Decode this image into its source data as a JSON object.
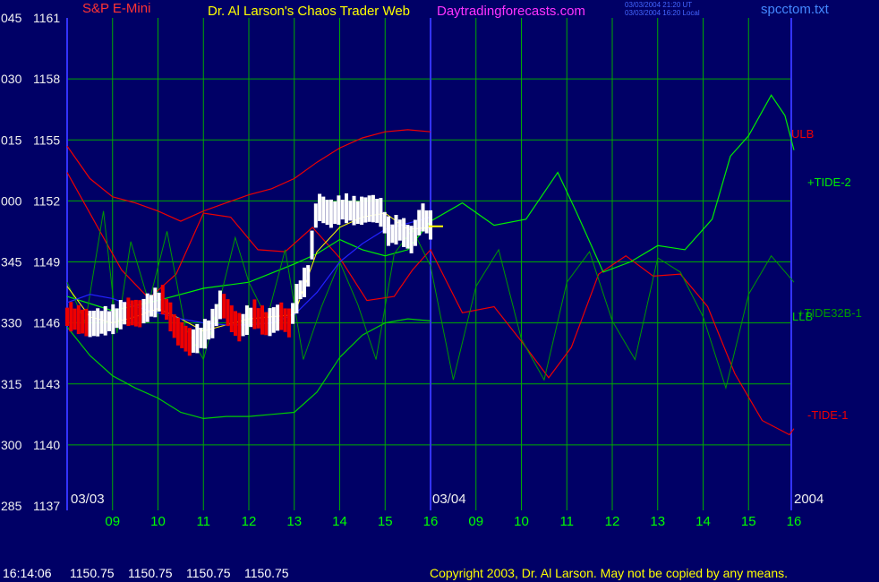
{
  "header": {
    "symbol_label": "S&P E-Mini",
    "title": "Dr. Al Larson's Chaos Trader Web",
    "site": "Daytradingforecasts.com",
    "timestamp_utc": "03/03/2004 21:20 UT",
    "timestamp_local": "03/03/2004 16:20 Local",
    "file": "spcctom.txt"
  },
  "footer": {
    "status_time": "16:14:06",
    "ohlc": [
      "1150.75",
      "1150.75",
      "1150.75",
      "1150.75"
    ],
    "copyright": "Copyright 2003, Dr. Al Larson. May not be copied by any means."
  },
  "colors": {
    "background": "#000066",
    "grid": "#00aa00",
    "axis_labels": "#f0f0f0",
    "time_labels": "#00ff00",
    "divider": "#3333ff",
    "price_bar": "#ffffff",
    "price_bar_down": "#ee0000",
    "ulb": "#ee0000",
    "llb": "#00cc00",
    "tide2": "#00ee00",
    "tide1": "#ee0000",
    "tide32b": "#009900",
    "moving_average_yellow": "#ffff00",
    "moving_average_blue": "#2222ff",
    "site": "#ff33ff",
    "symbol": "#ff3333",
    "title": "#ffff00",
    "file": "#4488ff",
    "copyright": "#ffff00",
    "status": "#ffffff"
  },
  "chart_data": {
    "type": "line",
    "instrument": "S&P E-Mini",
    "y_axis": {
      "ylim": [
        1137,
        1161
      ],
      "prices": [
        "1161",
        "1158",
        "1155",
        "1152",
        "1149",
        "1146",
        "1143",
        "1140",
        "1137"
      ],
      "angles": [
        "045",
        "030",
        "015",
        "000",
        "345",
        "330",
        "315",
        "300",
        "285"
      ]
    },
    "x_axis": {
      "sessions": [
        "03/03",
        "03/04"
      ],
      "year": "2004",
      "hours": [
        "09",
        "10",
        "11",
        "12",
        "13",
        "14",
        "15",
        "16"
      ],
      "range_hours": [
        8,
        16
      ]
    },
    "legend": [
      "ULB",
      "+TIDE-2",
      "+TIDE32B-1",
      "LLB",
      "-TIDE-1"
    ],
    "last_price": 1150.75,
    "series": [
      {
        "name": "price",
        "session": "03/03",
        "x": [
          8.0,
          8.5,
          9.0,
          9.3,
          9.6,
          9.9,
          10.1,
          10.4,
          10.7,
          11.0,
          11.2,
          11.4,
          11.6,
          11.8,
          12.1,
          12.4,
          12.7,
          12.9,
          13.1,
          13.3,
          13.5,
          13.8,
          14.1,
          14.4,
          14.7,
          14.9,
          15.1,
          15.3,
          15.6,
          15.8,
          16.0
        ],
        "y": [
          1146.3,
          1145.9,
          1146.1,
          1146.5,
          1146.4,
          1146.9,
          1147.1,
          1145.6,
          1145.0,
          1145.3,
          1145.9,
          1147.0,
          1146.2,
          1145.7,
          1146.4,
          1145.9,
          1146.3,
          1145.9,
          1147.5,
          1148.2,
          1151.7,
          1151.3,
          1151.6,
          1151.4,
          1151.6,
          1151.4,
          1150.3,
          1150.6,
          1150.0,
          1151.2,
          1150.75
        ]
      },
      {
        "name": "ULB",
        "session": "03/03",
        "x": [
          8.0,
          8.5,
          9.0,
          9.5,
          10.0,
          10.5,
          11.0,
          11.5,
          12.0,
          12.5,
          13.0,
          13.5,
          14.0,
          14.5,
          15.0,
          15.5,
          16.0
        ],
        "y": [
          1154.7,
          1153.1,
          1152.2,
          1151.9,
          1151.5,
          1151.0,
          1151.5,
          1151.9,
          1152.3,
          1152.6,
          1153.1,
          1153.9,
          1154.6,
          1155.1,
          1155.4,
          1155.5,
          1155.4
        ]
      },
      {
        "name": "LLB",
        "session": "03/03",
        "x": [
          8.0,
          8.5,
          9.0,
          9.5,
          10.0,
          10.5,
          11.0,
          11.5,
          12.0,
          12.5,
          13.0,
          13.5,
          14.0,
          14.5,
          15.0,
          15.5,
          16.0
        ],
        "y": [
          1145.8,
          1144.4,
          1143.4,
          1142.8,
          1142.3,
          1141.6,
          1141.3,
          1141.4,
          1141.4,
          1141.5,
          1141.6,
          1142.6,
          1144.3,
          1145.4,
          1146.0,
          1146.2,
          1146.1
        ]
      },
      {
        "name": "-TIDE-1",
        "session": "all",
        "x": [
          8.0,
          8.6,
          9.2,
          9.8,
          10.4,
          11.0,
          11.6,
          12.2,
          12.8,
          13.4,
          14.0,
          14.6,
          15.2,
          15.6,
          16.0,
          16.7,
          17.4,
          18.0,
          18.6,
          19.1,
          19.7,
          20.3,
          20.9,
          21.5,
          22.1,
          22.7,
          23.3,
          23.9,
          24.0
        ],
        "y": [
          1153.4,
          1151.0,
          1148.6,
          1147.2,
          1148.4,
          1151.4,
          1151.2,
          1149.6,
          1149.5,
          1150.7,
          1149.2,
          1147.1,
          1147.3,
          1148.6,
          1149.6,
          1146.5,
          1146.8,
          1145.1,
          1143.3,
          1144.8,
          1148.4,
          1149.3,
          1148.3,
          1148.4,
          1146.8,
          1143.5,
          1141.2,
          1140.5,
          1140.8
        ]
      },
      {
        "name": "+TIDE-2",
        "session": "all",
        "x": [
          8.0,
          9.0,
          10.0,
          11.0,
          12.0,
          13.0,
          13.5,
          14.0,
          14.5,
          15.0,
          15.5,
          16.0,
          16.7,
          17.4,
          18.1,
          18.8,
          19.2,
          19.8,
          20.4,
          21.0,
          21.6,
          22.2,
          22.6,
          23.0,
          23.5,
          23.8,
          24.0
        ],
        "y": [
          1147.3,
          1146.6,
          1147.1,
          1147.7,
          1148.0,
          1148.9,
          1149.4,
          1150.1,
          1149.6,
          1149.3,
          1149.6,
          1151.0,
          1151.9,
          1150.8,
          1151.1,
          1153.4,
          1151.5,
          1148.5,
          1149.0,
          1149.8,
          1149.6,
          1151.1,
          1154.2,
          1155.2,
          1157.2,
          1156.2,
          1154.5
        ]
      },
      {
        "name": "+TIDE32B-1",
        "session": "all",
        "x": [
          8.0,
          8.4,
          8.8,
          9.1,
          9.4,
          9.8,
          10.2,
          10.6,
          11.0,
          11.4,
          11.7,
          12.0,
          12.4,
          12.8,
          13.2,
          13.6,
          14.0,
          14.4,
          14.8,
          15.2,
          15.6,
          16.0,
          16.5,
          17.0,
          17.5,
          18.0,
          18.5,
          19.0,
          19.5,
          20.0,
          20.5,
          21.0,
          21.5,
          22.0,
          22.5,
          23.0,
          23.5,
          24.0
        ],
        "y": [
          1148.0,
          1146.0,
          1151.5,
          1145.5,
          1150.0,
          1147.0,
          1150.5,
          1145.8,
          1144.2,
          1147.5,
          1150.2,
          1148.0,
          1146.2,
          1149.6,
          1144.2,
          1146.8,
          1149.0,
          1146.9,
          1144.2,
          1149.4,
          1150.6,
          1148.8,
          1143.2,
          1147.8,
          1149.6,
          1145.2,
          1143.2,
          1148.0,
          1149.5,
          1146.1,
          1144.2,
          1149.2,
          1148.5,
          1146.3,
          1142.8,
          1147.4,
          1149.3,
          1148.0
        ]
      },
      {
        "name": "moving-average-yellow",
        "session": "03/03",
        "x": [
          8.0,
          8.5,
          9.0,
          9.5,
          10.0,
          10.5,
          11.0,
          11.5,
          12.0,
          12.5,
          13.0,
          13.5,
          14.0,
          14.5,
          15.0,
          15.5,
          16.0
        ],
        "y": [
          1147.8,
          1146.3,
          1146.0,
          1146.3,
          1146.7,
          1146.2,
          1145.6,
          1145.9,
          1146.2,
          1146.3,
          1146.4,
          1149.5,
          1150.7,
          1151.2,
          1151.4,
          1150.6,
          1150.7
        ]
      },
      {
        "name": "moving-average-blue",
        "session": "03/03",
        "x": [
          8.0,
          8.5,
          9.0,
          9.5,
          10.0,
          10.5,
          11.0,
          11.5,
          12.0,
          12.5,
          13.0,
          13.5,
          14.0,
          14.5,
          15.0,
          15.5,
          16.0
        ],
        "y": [
          1147.0,
          1147.4,
          1147.2,
          1146.8,
          1146.5,
          1146.2,
          1146.0,
          1145.9,
          1145.9,
          1146.0,
          1146.4,
          1147.5,
          1149.0,
          1149.9,
          1150.6,
          1150.9,
          1151.2
        ]
      }
    ]
  }
}
